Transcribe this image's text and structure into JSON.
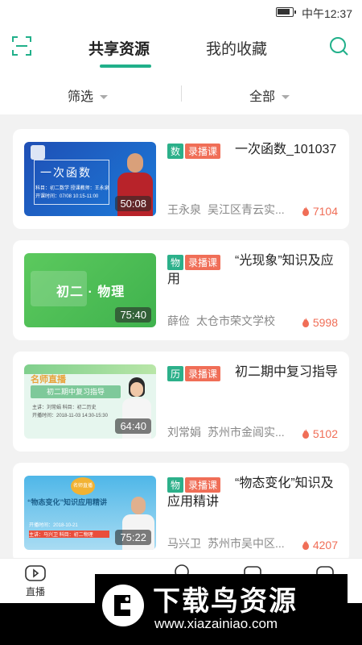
{
  "status_bar": {
    "time": "中午12:37"
  },
  "header": {
    "tabs": [
      {
        "label": "共享资源",
        "active": true
      },
      {
        "label": "我的收藏",
        "active": false
      }
    ],
    "accent_color": "#21b08a"
  },
  "filters": [
    {
      "label": "筛选"
    },
    {
      "label": "全部"
    }
  ],
  "cards": [
    {
      "subject": "数",
      "type": "录播课",
      "title": "一次函数_101037",
      "teacher": "王永泉",
      "school": "吴江区青云实...",
      "count": "7104",
      "duration": "50:08",
      "thumb": {
        "main": "一次函数",
        "sub1": "科目：初二数学  授课教师：王永泉",
        "sub2": "开课时间：07/08  10:15-11:00"
      }
    },
    {
      "subject": "物",
      "type": "录播课",
      "title": "“光现象”知识及应用",
      "teacher": "薛俭",
      "school": "太仓市荣文学校",
      "count": "5998",
      "duration": "75:40",
      "thumb": {
        "main": "初二 · 物理"
      }
    },
    {
      "subject": "历",
      "type": "录播课",
      "title": "初二期中复习指导",
      "teacher": "刘常娟",
      "school": "苏州市金阊实...",
      "count": "5102",
      "duration": "64:40",
      "thumb": {
        "brand": "名师直播",
        "main": "初二期中复习指导",
        "sub1": "主讲：刘常娟     科目：初二历史",
        "sub2": "开播时间：2018-11-03 14:30-15:30"
      }
    },
    {
      "subject": "物",
      "type": "录播课",
      "title": "“物态变化”知识及应用精讲",
      "teacher": "马兴卫",
      "school": "苏州市吴中区...",
      "count": "4207",
      "duration": "75:22",
      "thumb": {
        "badge": "名师直播",
        "main": "“物态变化”知识应用精讲",
        "sub1": "开播时间：2018-10-21",
        "sub2": "主讲：马兴卫  科目：初二物理"
      }
    }
  ],
  "bottom_nav": [
    {
      "label": "直播",
      "icon": "video-camera-icon"
    }
  ],
  "watermark": {
    "title": "下载鸟资源",
    "url": "www.xiazainiao.com"
  }
}
